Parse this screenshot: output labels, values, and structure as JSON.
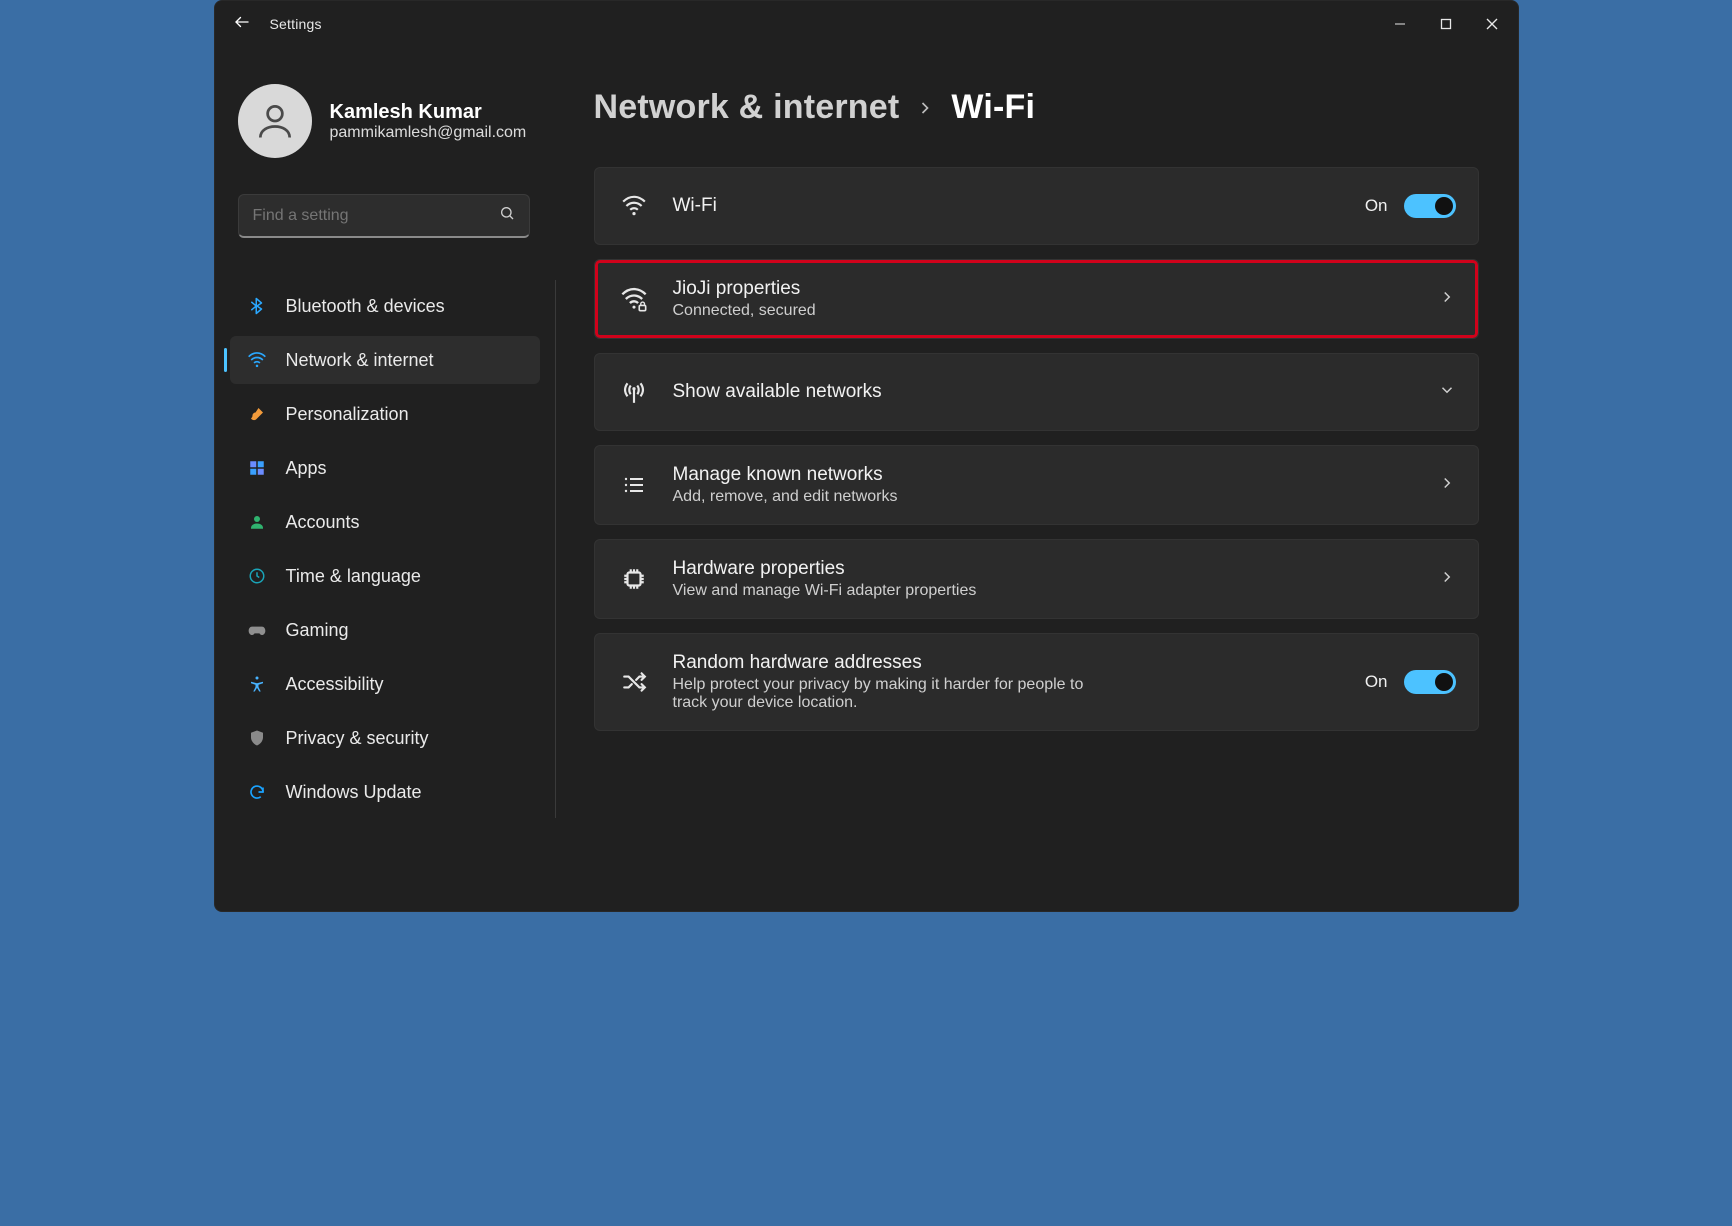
{
  "window": {
    "title": "Settings"
  },
  "user": {
    "name": "Kamlesh Kumar",
    "email": "pammikamlesh@gmail.com"
  },
  "search": {
    "placeholder": "Find a setting"
  },
  "sidebar": {
    "items": [
      {
        "label": "Bluetooth & devices"
      },
      {
        "label": "Network & internet"
      },
      {
        "label": "Personalization"
      },
      {
        "label": "Apps"
      },
      {
        "label": "Accounts"
      },
      {
        "label": "Time & language"
      },
      {
        "label": "Gaming"
      },
      {
        "label": "Accessibility"
      },
      {
        "label": "Privacy & security"
      },
      {
        "label": "Windows Update"
      }
    ],
    "activeIndex": 1
  },
  "breadcrumb": {
    "parent": "Network & internet",
    "current": "Wi-Fi"
  },
  "cards": {
    "wifi": {
      "title": "Wi-Fi",
      "state": "On"
    },
    "network": {
      "title": "JioJi properties",
      "status": "Connected, secured"
    },
    "available": {
      "title": "Show available networks"
    },
    "known": {
      "title": "Manage known networks",
      "sub": "Add, remove, and edit networks"
    },
    "hardware": {
      "title": "Hardware properties",
      "sub": "View and manage Wi-Fi adapter properties"
    },
    "random": {
      "title": "Random hardware addresses",
      "sub": "Help protect your privacy by making it harder for people to track your device location.",
      "state": "On"
    }
  }
}
